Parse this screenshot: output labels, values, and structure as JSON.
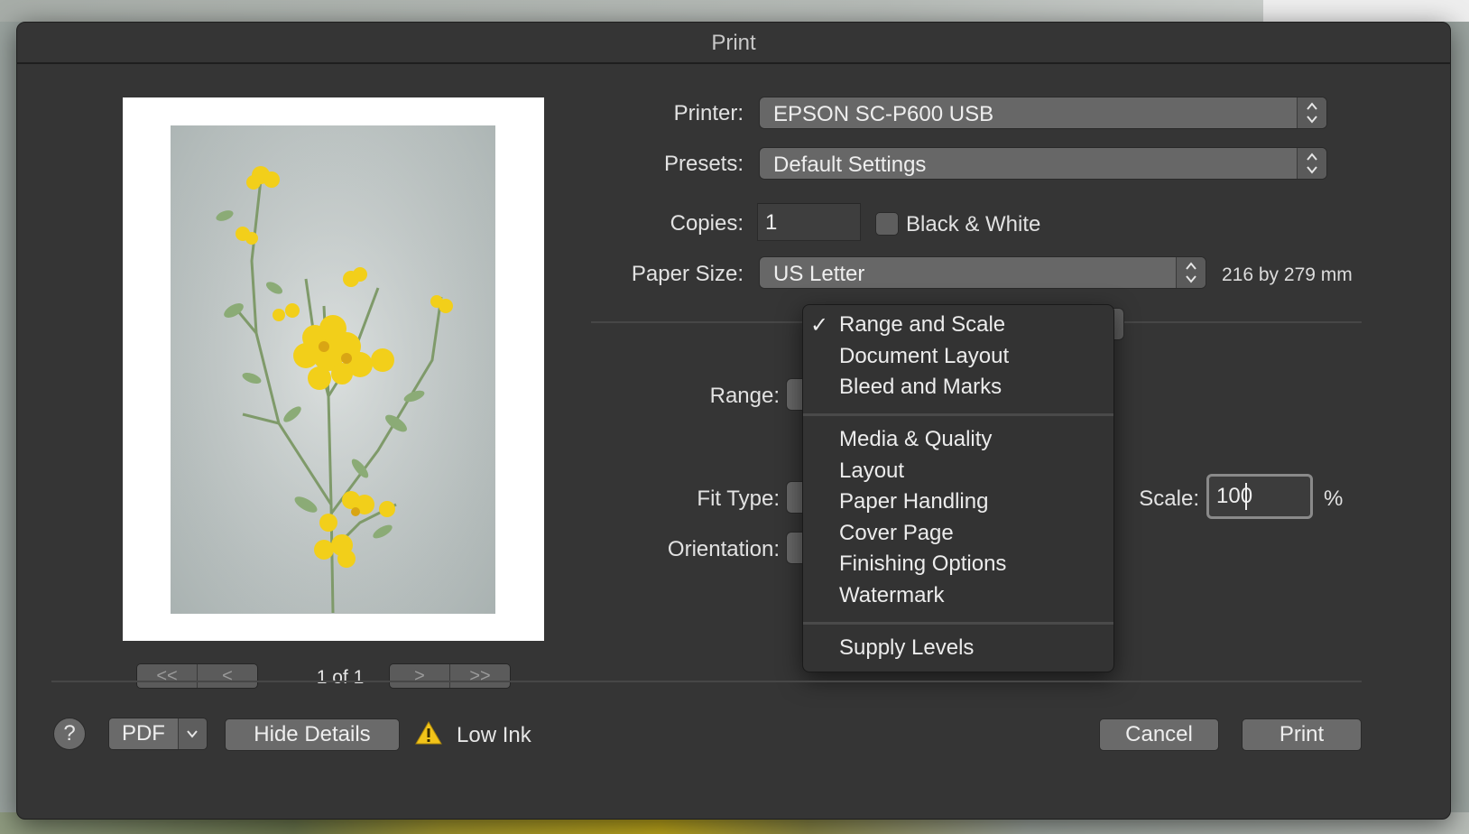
{
  "dialog": {
    "title": "Print"
  },
  "preview": {
    "page_indicator": "1 of 1",
    "nav": {
      "first": "<<",
      "prev": "<",
      "next": ">",
      "last": ">>"
    }
  },
  "printer": {
    "label": "Printer:",
    "value": "EPSON SC-P600 USB"
  },
  "presets": {
    "label": "Presets:",
    "value": "Default Settings"
  },
  "copies": {
    "label": "Copies:",
    "value": "1"
  },
  "black_white": {
    "label": "Black & White",
    "checked": false
  },
  "paper_size": {
    "label": "Paper Size:",
    "value": "US Letter",
    "dimensions": "216 by 279 mm"
  },
  "range": {
    "label": "Range:"
  },
  "fit_type": {
    "label": "Fit Type:"
  },
  "orientation": {
    "label": "Orientation:"
  },
  "scale": {
    "label": "Scale:",
    "value": "100",
    "unit": "%"
  },
  "panel_menu": {
    "selected": "Range and Scale",
    "check_mark": "✓",
    "group1": [
      "Range and Scale",
      "Document Layout",
      "Bleed and Marks"
    ],
    "group2": [
      "Media & Quality",
      "Layout",
      "Paper Handling",
      "Cover Page",
      "Finishing Options",
      "Watermark"
    ],
    "group3": [
      "Supply Levels"
    ]
  },
  "footer": {
    "help": "?",
    "pdf": "PDF",
    "hide_details": "Hide Details",
    "low_ink": "Low Ink",
    "cancel": "Cancel",
    "print": "Print"
  },
  "icons": {
    "stepper": "up-down-chevron-icon",
    "warning": "warning-triangle-icon",
    "dropdown": "chevron-down-icon"
  },
  "colors": {
    "dialog_bg": "#353535",
    "control_bg": "#676767",
    "warning": "#f2c419"
  }
}
